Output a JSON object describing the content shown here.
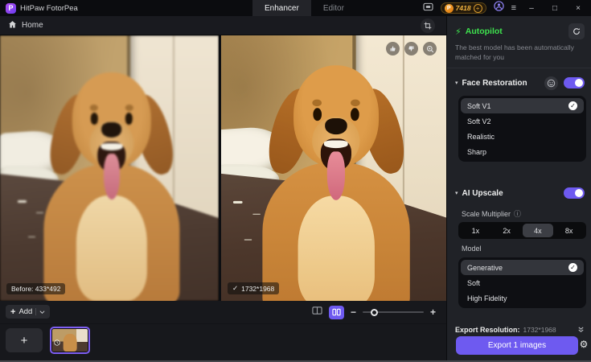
{
  "titlebar": {
    "app_name": "HitPaw FotorPea",
    "logo_letter": "P",
    "tabs": [
      {
        "label": "Enhancer",
        "active": true
      },
      {
        "label": "Editor",
        "active": false
      }
    ],
    "credits": "7418"
  },
  "breadcrumb": {
    "home_label": "Home"
  },
  "viewer": {
    "before_label": "Before: 433*492",
    "after_check": "✓",
    "after_label": "1732*1968"
  },
  "autopilot": {
    "title": "Autopilot",
    "description": "The best model has been automatically matched for you"
  },
  "face_restoration": {
    "title": "Face Restoration",
    "enabled": true,
    "options": [
      {
        "label": "Soft V1",
        "selected": true
      },
      {
        "label": "Soft V2",
        "selected": false
      },
      {
        "label": "Realistic",
        "selected": false
      },
      {
        "label": "Sharp",
        "selected": false
      }
    ]
  },
  "ai_upscale": {
    "title": "AI Upscale",
    "enabled": true,
    "scale_label": "Scale Multiplier",
    "scales": [
      {
        "label": "1x",
        "selected": false
      },
      {
        "label": "2x",
        "selected": false
      },
      {
        "label": "4x",
        "selected": true
      },
      {
        "label": "8x",
        "selected": false
      }
    ],
    "model_label": "Model",
    "models": [
      {
        "label": "Generative",
        "selected": true
      },
      {
        "label": "Soft",
        "selected": false
      },
      {
        "label": "High Fidelity",
        "selected": false
      }
    ]
  },
  "export": {
    "resolution_label": "Export Resolution:",
    "resolution_value": "1732*1968",
    "button_label": "Export 1 images"
  },
  "footer": {
    "add_label": "Add"
  },
  "icons": {
    "caret": "▾",
    "check": "✓",
    "bolt": "⚡",
    "info": "ⓘ",
    "gear": "⚙",
    "menu": "≡",
    "minimize": "–",
    "maximize": "□",
    "close": "×",
    "plus": "+",
    "minus": "−"
  },
  "colors": {
    "accent": "#6e5af0",
    "autopilot_green": "#3ee24e",
    "coin_gold": "#f0b23e"
  }
}
